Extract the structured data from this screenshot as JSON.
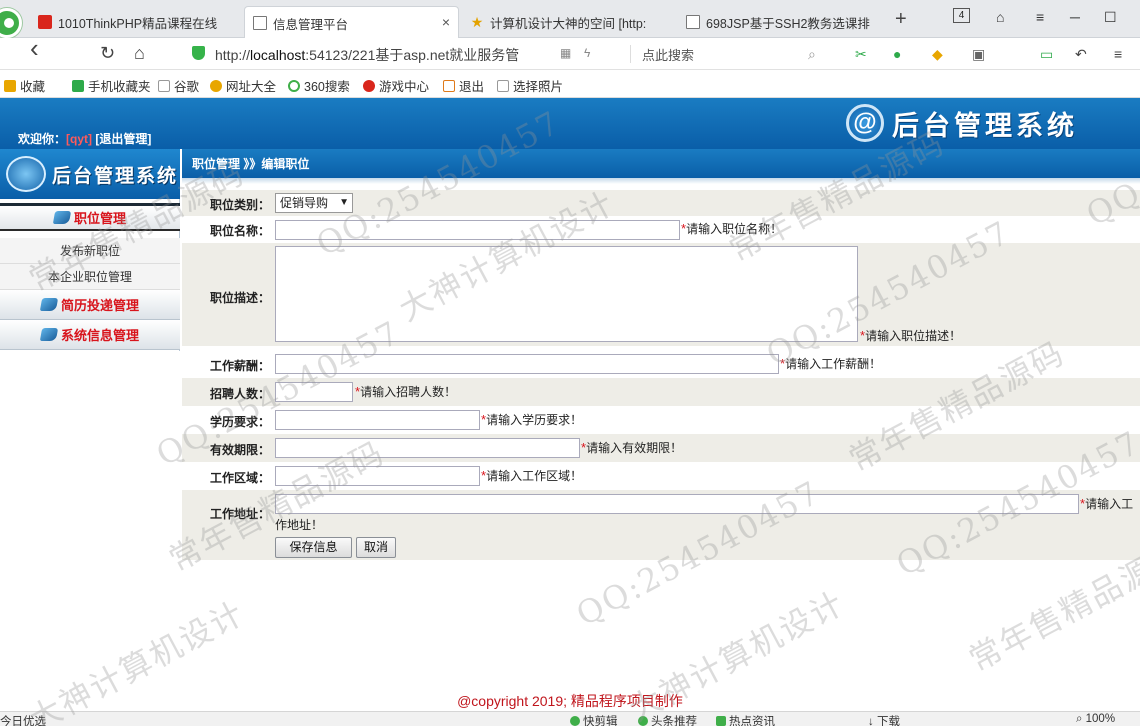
{
  "browser": {
    "tabs": [
      {
        "title": "1010ThinkPHP精品课程在线"
      },
      {
        "title": "信息管理平台",
        "close": "×"
      },
      {
        "title": "计算机设计大神的空间 [http:"
      },
      {
        "title": "698JSP基于SSH2教务选课排"
      }
    ],
    "new_tab": "+",
    "tab_count": "4",
    "url_scheme": "http://",
    "url_host": "localhost",
    "url_path": ":54123/221基于asp.net就业服务管",
    "search_label": "点此搜索",
    "controls": {
      "back": "‹",
      "reload": "↻",
      "home": "⌂",
      "menu": "≡",
      "minimize": "─",
      "maximize": "☐"
    },
    "bookmarks": [
      {
        "label": "收藏",
        "color": "#e8a600"
      },
      {
        "label": "手机收藏夹",
        "color": "#2eaa4a"
      },
      {
        "label": "谷歌",
        "color": "#bbbbbb"
      },
      {
        "label": "网址大全",
        "color": "#e8a600"
      },
      {
        "label": "360搜索",
        "color": "#3fae49"
      },
      {
        "label": "游戏中心",
        "color": "#d9261c"
      },
      {
        "label": "退出",
        "color": "#e07a1a"
      },
      {
        "label": "选择照片",
        "color": "#bbbbbb"
      }
    ]
  },
  "header": {
    "welcome_prefix": "欢迎你：",
    "username": "[qyt]",
    "logout": "[退出管理]",
    "system_title": "后台管理系统",
    "logo_glyph": "@"
  },
  "sidebar": {
    "logo_text": "后台管理系统",
    "menus": [
      {
        "label": "职位管理",
        "items": [
          "发布新职位",
          "本企业职位管理"
        ]
      },
      {
        "label": "简历投递管理",
        "items": []
      },
      {
        "label": "系统信息管理",
        "items": []
      }
    ]
  },
  "breadcrumb": "职位管理 》》编辑职位",
  "form": {
    "category": {
      "label": "职位类别：",
      "value": "促销导购",
      "arrow": "▼"
    },
    "name": {
      "label": "职位名称：",
      "value": "",
      "hint": "请输入职位名称！"
    },
    "description": {
      "label": "职位描述：",
      "value": "",
      "hint": "请输入职位描述！"
    },
    "salary": {
      "label": "工作薪酬：",
      "value": "",
      "hint": "请输入工作薪酬！"
    },
    "headcount": {
      "label": "招聘人数：",
      "value": "",
      "hint": "请输入招聘人数！"
    },
    "education": {
      "label": "学历要求：",
      "value": "",
      "hint": "请输入学历要求！"
    },
    "validity": {
      "label": "有效期限：",
      "value": "",
      "hint": "请输入有效期限！"
    },
    "area": {
      "label": "工作区域：",
      "value": "",
      "hint": "请输入工作区域！"
    },
    "address": {
      "label": "工作地址：",
      "value": "",
      "hint": "请输入工",
      "hint_wrap": "作地址！"
    },
    "required_mark": "*",
    "save_button": "保存信息",
    "cancel_button": "取消"
  },
  "footer": {
    "copyright": "@copyright 2019; 精品程序项目制作"
  },
  "statusbar": {
    "left": "今日优选",
    "items": [
      "快剪辑",
      "头条推荐",
      "热点资讯",
      "下载"
    ],
    "zoom": "100%"
  },
  "watermark": [
    "QQ:254540457",
    "大神计算机设计",
    "常年售精品源码"
  ],
  "colors": {
    "header_blue": "#0a5ea8",
    "menu_red": "#d8141c",
    "copyright_red": "#c0151c",
    "alt_row": "#eeede7"
  }
}
